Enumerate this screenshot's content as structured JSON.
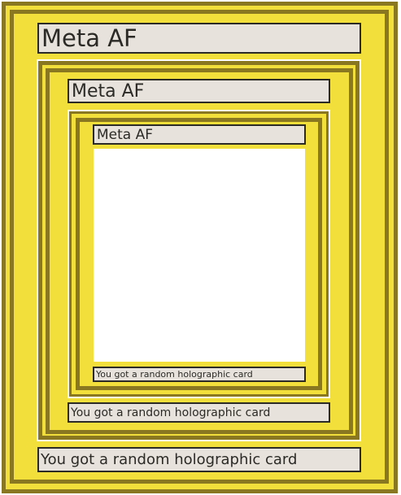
{
  "cards": [
    {
      "title": "Meta AF",
      "caption": "You got a random holographic card"
    },
    {
      "title": "Meta AF",
      "caption": "You got a random holographic card"
    },
    {
      "title": "Meta AF",
      "caption": "You got a random holographic card"
    }
  ],
  "colors": {
    "card_fill": "#f3df3c",
    "card_border": "#8a7722",
    "label_fill": "#e7e3dc",
    "label_border": "#2b2a26",
    "art_fill": "#ffffff"
  }
}
